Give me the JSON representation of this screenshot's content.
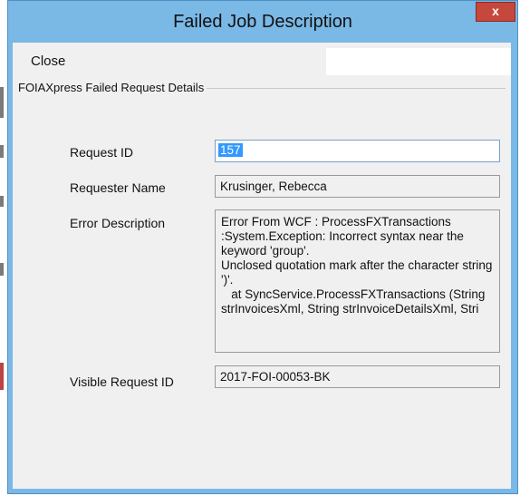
{
  "window": {
    "title": "Failed Job Description",
    "close_glyph": "x"
  },
  "menu": {
    "close_label": "Close"
  },
  "group": {
    "legend": "FOIAXpress Failed Request Details"
  },
  "fields": {
    "request_id_label": "Request ID",
    "request_id_value": "157",
    "requester_name_label": "Requester Name",
    "requester_name_value": "Krusinger, Rebecca",
    "error_description_label": "Error Description",
    "error_description_value": "Error From WCF : ProcessFXTransactions :System.Exception: Incorrect syntax near the keyword 'group'.\nUnclosed quotation mark after the character string ')'.\n   at SyncService.ProcessFXTransactions (String strInvoicesXml, String strInvoiceDetailsXml, Stri",
    "visible_request_id_label": "Visible Request ID",
    "visible_request_id_value": "2017-FOI-00053-BK"
  },
  "colors": {
    "title_bar": "#7ab8e6",
    "close_button": "#c6473b",
    "selection": "#3399ff"
  }
}
